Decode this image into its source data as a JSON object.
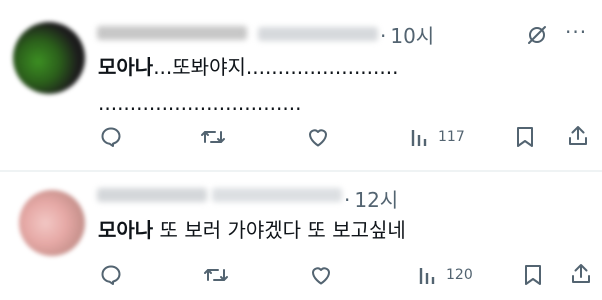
{
  "tweets": [
    {
      "time": "10시",
      "author_bold": "모아나",
      "text_rest": "...또봐야지........................",
      "text_line2": "................................",
      "actions": {
        "views": "117"
      },
      "icons": [
        "reply-icon",
        "retweet-icon",
        "like-icon",
        "views-icon",
        "bookmark-icon",
        "share-icon"
      ]
    },
    {
      "time": "12시",
      "author_bold": "모아나",
      "text_rest": " 또 보러 가야겠다 또 보고싶네",
      "actions": {
        "views": "120"
      },
      "icons": [
        "reply-icon",
        "retweet-icon",
        "like-icon",
        "views-icon",
        "bookmark-icon",
        "share-icon"
      ]
    }
  ],
  "colors": {
    "icon": "#536471",
    "text": "#0f1419",
    "divider": "#eff3f4"
  }
}
